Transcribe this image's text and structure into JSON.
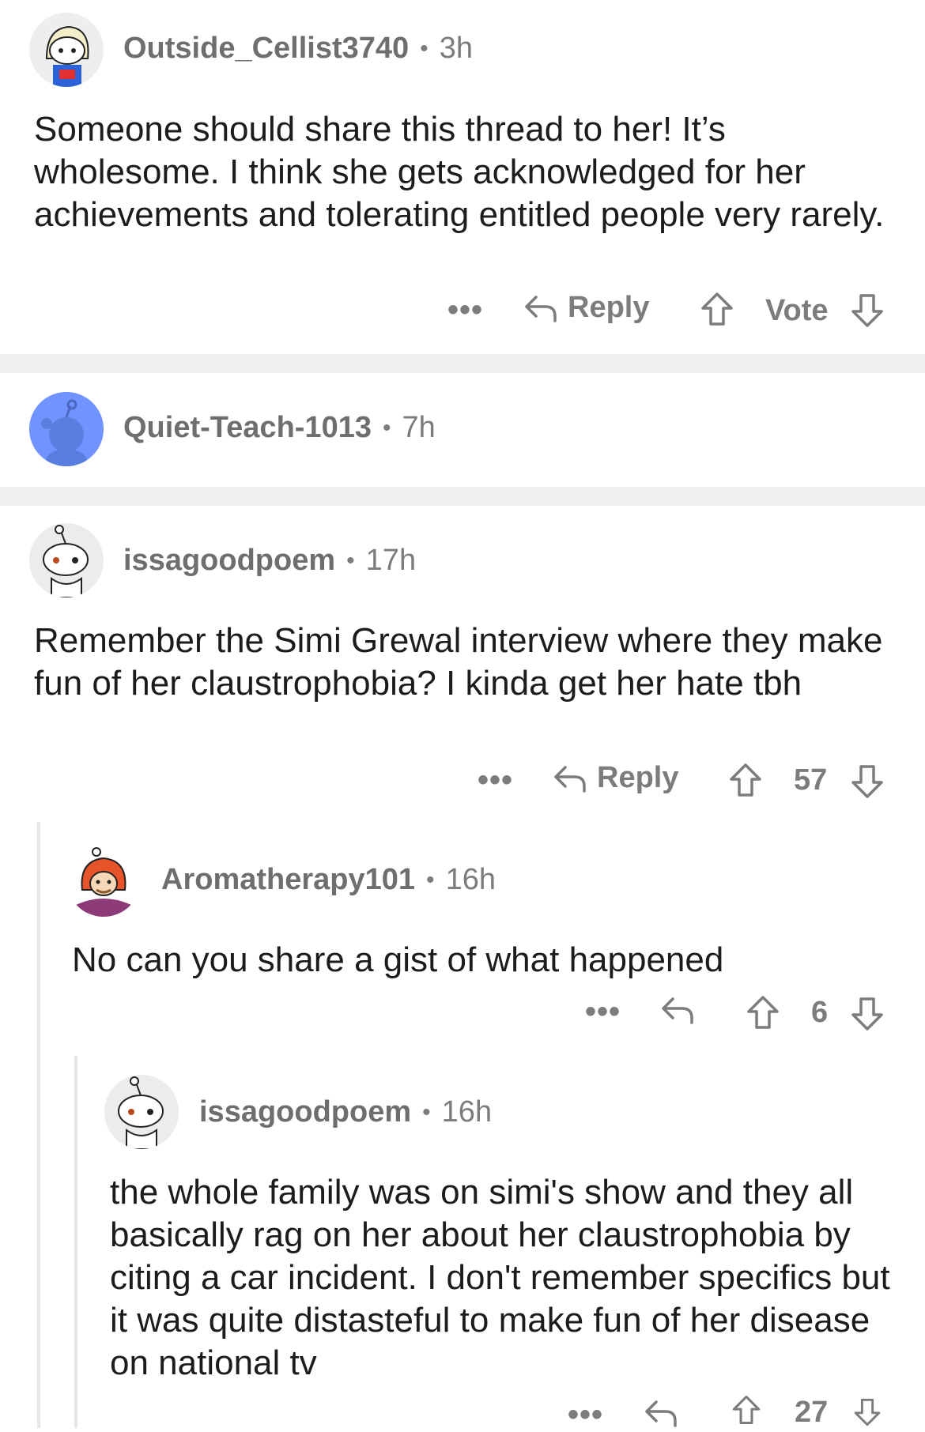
{
  "comments": [
    {
      "username": "Outside_Cellist3740",
      "age": "3h",
      "body": "Someone should share this thread to her! It’s wholesome. I think she gets acknowledged for her achievements and tolerating entitled people very rarely.",
      "actions": {
        "reply_label": "Reply",
        "vote_label": "Vote"
      }
    },
    {
      "username": "Quiet-Teach-1013",
      "age": "7h"
    },
    {
      "username": "issagoodpoem",
      "age": "17h",
      "body": "Remember the Simi Grewal interview where they make fun of her claustrophobia? I kinda get her hate tbh",
      "actions": {
        "reply_label": "Reply",
        "vote_count": "57"
      },
      "replies": [
        {
          "username": "Aromatherapy101",
          "age": "16h",
          "body": "No can you share a gist of what happened",
          "actions": {
            "vote_count": "6"
          },
          "replies": [
            {
              "username": "issagoodpoem",
              "age": "16h",
              "body": "the whole family was on simi's show and they all basically rag on her about her claustrophobia by citing a car incident. I don't remember specifics but it was quite distasteful to make fun of her disease on national tv",
              "actions": {
                "vote_count": "27"
              }
            }
          ]
        }
      ]
    }
  ],
  "icons": {
    "more": "ellipsis-icon",
    "reply": "reply-arrow-icon",
    "upvote": "upvote-arrow-icon",
    "downvote": "downvote-arrow-icon"
  },
  "colors": {
    "text": "#1c1c1c",
    "meta": "#7c7c7c",
    "divider": "#f0f0f0",
    "thread_line": "#e6e6e6",
    "avatar_blue": "#7193ff"
  }
}
